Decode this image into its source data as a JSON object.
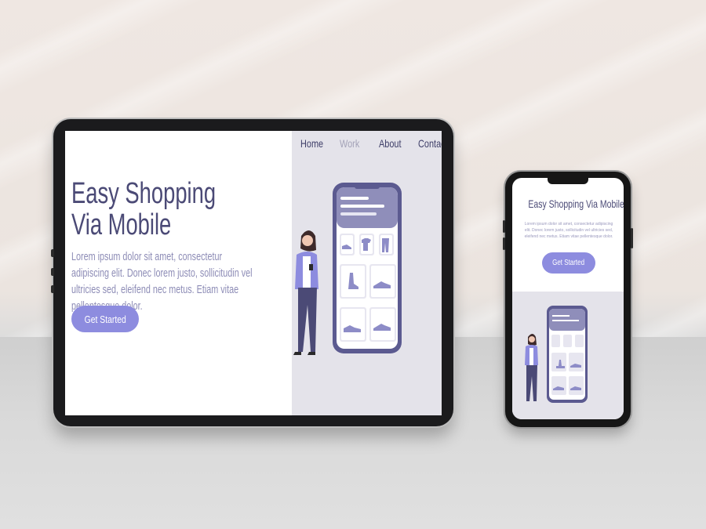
{
  "tablet": {
    "nav": [
      "Home",
      "Work",
      "About",
      "Contact"
    ],
    "hero_title_line1": "Easy Shopping",
    "hero_title_line2": "Via Mobile",
    "hero_body": "Lorem ipsum dolor sit amet, consectetur adipiscing elit. Donec lorem justo, sollicitudin vel ultricies sed, eleifend nec metus. Etiam vitae pellentesque dolor.",
    "cta_label": "Get Started"
  },
  "phone": {
    "hero_title": "Easy Shopping Via Mobile",
    "hero_body": "Lorem ipsum dolor sit amet, consectetur adipiscing elit. Donec lorem justo, sollicitudin vel ultricies sed, eleifend nec metus. Etiam vitae pellentesque dolor.",
    "cta_label": "Get Started"
  },
  "colors": {
    "accent": "#8d8cdf",
    "heading": "#4b4a76",
    "body_text": "#8d8cb6",
    "panel_bg": "#e4e3ea"
  },
  "icons": [
    "shoe-icon",
    "tshirt-icon",
    "pants-icon",
    "boot-icon",
    "sneaker-icon"
  ]
}
